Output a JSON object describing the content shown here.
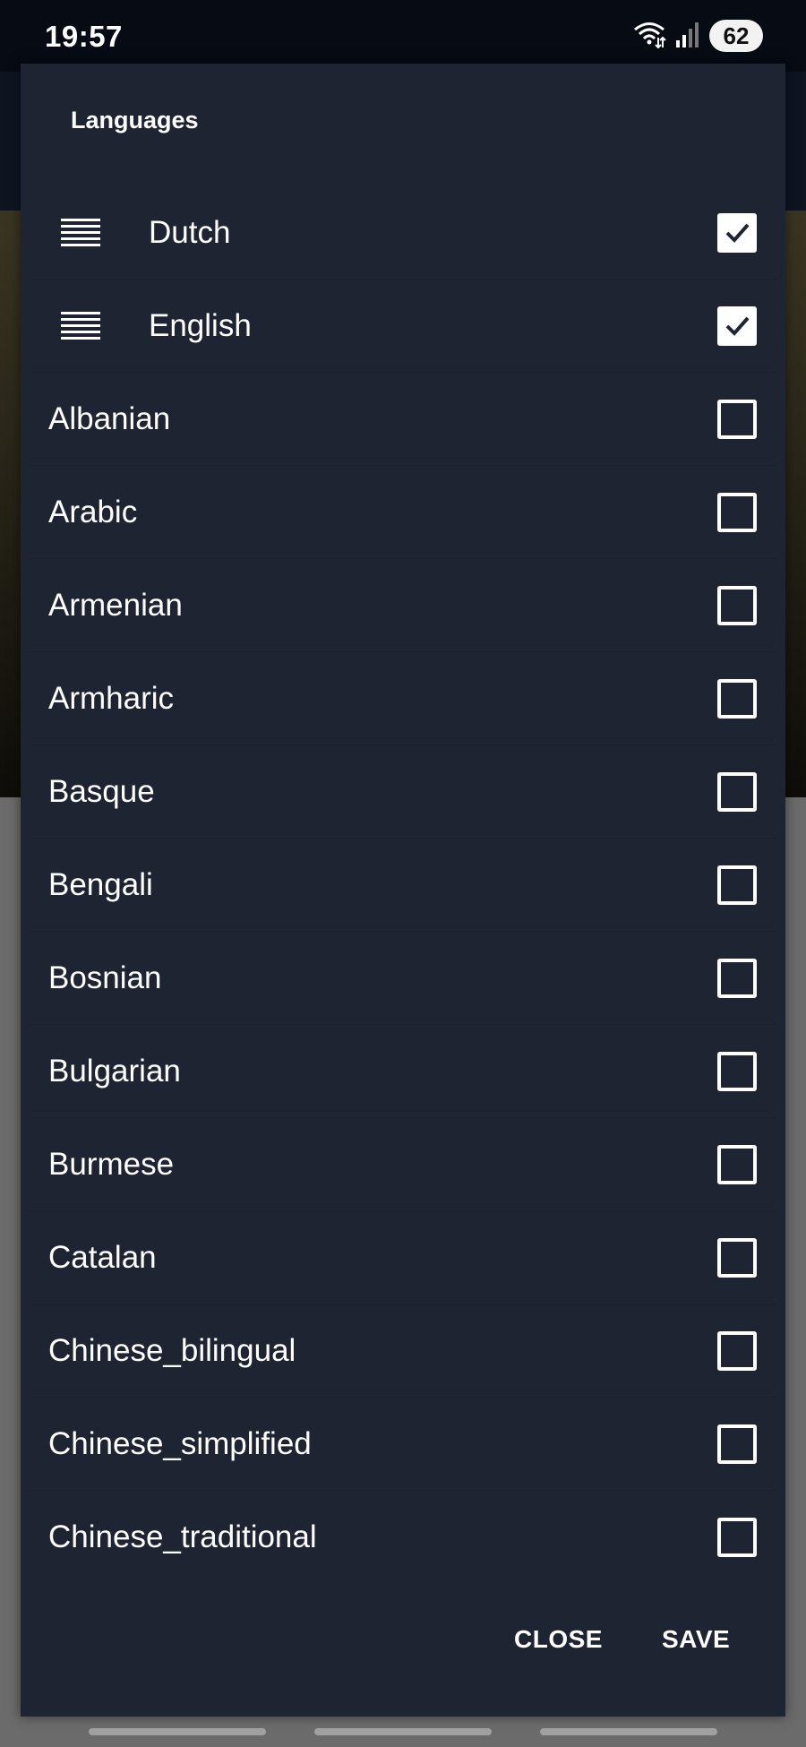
{
  "status_bar": {
    "time": "19:57",
    "battery": "62",
    "icons": [
      "wifi-icon",
      "signal-icon",
      "battery-icon"
    ]
  },
  "dialog": {
    "title": "Languages",
    "selected_languages": [
      {
        "label": "Dutch",
        "checked": true
      },
      {
        "label": "English",
        "checked": true
      }
    ],
    "languages": [
      {
        "label": "Albanian",
        "checked": false
      },
      {
        "label": "Arabic",
        "checked": false
      },
      {
        "label": "Armenian",
        "checked": false
      },
      {
        "label": "Armharic",
        "checked": false
      },
      {
        "label": "Basque",
        "checked": false
      },
      {
        "label": "Bengali",
        "checked": false
      },
      {
        "label": "Bosnian",
        "checked": false
      },
      {
        "label": "Bulgarian",
        "checked": false
      },
      {
        "label": "Burmese",
        "checked": false
      },
      {
        "label": "Catalan",
        "checked": false
      },
      {
        "label": "Chinese_bilingual",
        "checked": false
      },
      {
        "label": "Chinese_simplified",
        "checked": false
      },
      {
        "label": "Chinese_traditional",
        "checked": false
      }
    ],
    "actions": {
      "close_label": "CLOSE",
      "save_label": "SAVE"
    }
  },
  "colors": {
    "dialog_background": "#1f2433",
    "text": "#ffffff",
    "status_bar_background": "#060b14"
  }
}
